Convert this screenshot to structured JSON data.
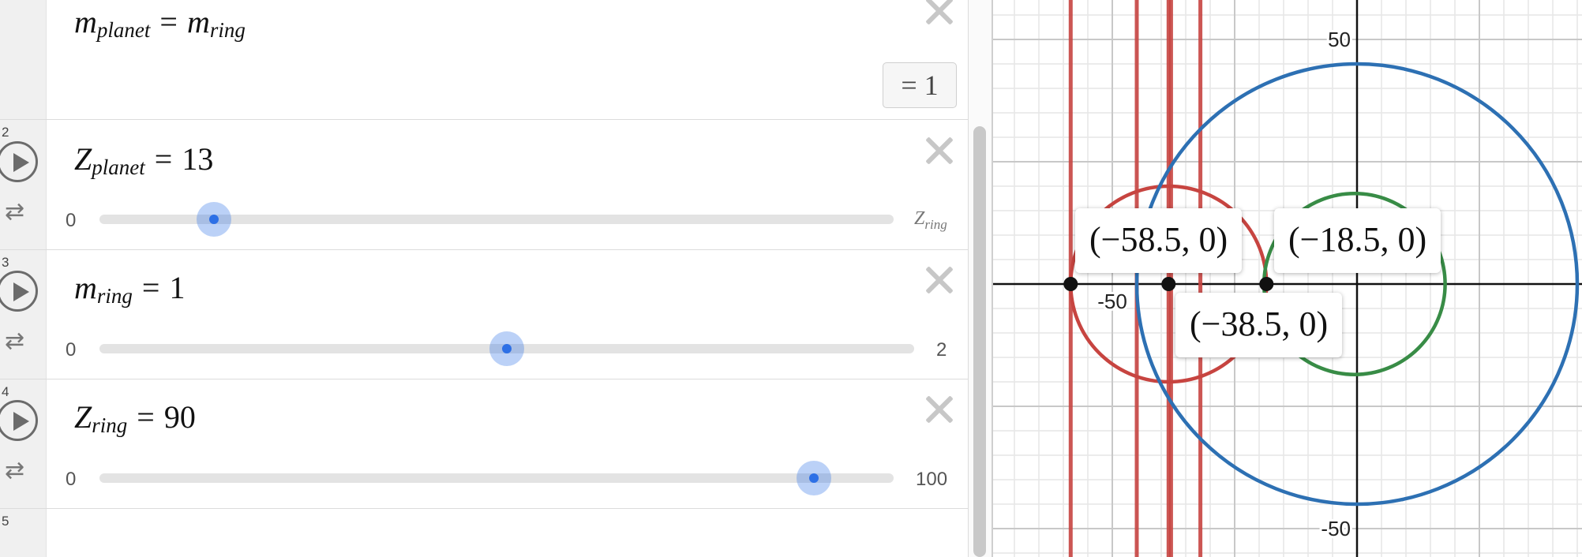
{
  "expressions": [
    {
      "row_num": "",
      "lhs_var": "m",
      "lhs_sub": "planet",
      "rhs_var": "m",
      "rhs_sub": "ring",
      "result": "= 1"
    },
    {
      "row_num": "2",
      "var": "Z",
      "sub": "planet",
      "value": "13",
      "slider": {
        "min": "0",
        "max_var": "Z",
        "max_sub": "ring",
        "level": 0.144
      }
    },
    {
      "row_num": "3",
      "var": "m",
      "sub": "ring",
      "value": "1",
      "slider": {
        "min": "0",
        "max": "2",
        "level": 0.5
      }
    },
    {
      "row_num": "4",
      "var": "Z",
      "sub": "ring",
      "value": "90",
      "slider": {
        "min": "0",
        "max": "100",
        "level": 0.9
      }
    },
    {
      "row_num": "5"
    }
  ],
  "graph": {
    "x_range": [
      -80,
      42
    ],
    "y_range": [
      -55,
      57
    ],
    "ticks": {
      "y_top": "50",
      "y_bottom": "-50",
      "x_left": "-50"
    },
    "circles": [
      {
        "cx": -38.5,
        "cy": 0,
        "r": 20,
        "color": "#c74440"
      },
      {
        "cx": 0,
        "cy": 0,
        "r": 45,
        "color": "#2d70b3"
      },
      {
        "cx": -0.5,
        "cy": 0,
        "r": 18.5,
        "color": "#388c46"
      }
    ],
    "vertical_lines": {
      "color": "#c74440",
      "x": [
        -58.5,
        -45,
        -38.5,
        -38,
        -32
      ]
    },
    "points": [
      {
        "x": -58.5,
        "y": 0,
        "label": "(−58.5, 0)"
      },
      {
        "x": -38.5,
        "y": 0,
        "label": "(−38.5, 0)"
      },
      {
        "x": -18.5,
        "y": 0,
        "label": "(−18.5, 0)"
      }
    ]
  },
  "colors": {
    "slider_accent": "#2d70e6",
    "red": "#c74440",
    "blue": "#2d70b3",
    "green": "#388c46"
  },
  "icons": {
    "play": "play-icon",
    "loop": "loop-icon",
    "close": "close-icon"
  }
}
